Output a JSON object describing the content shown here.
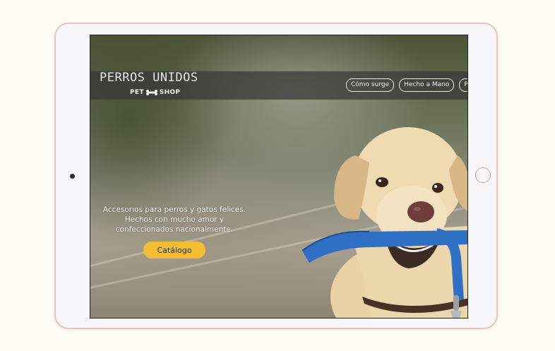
{
  "site": {
    "brand_name": "PERROS UNIDOS",
    "logo_left": "PET",
    "logo_right": "SHOP",
    "logo_icon": "bone-icon"
  },
  "nav": {
    "items": [
      {
        "label": "Cómo surge"
      },
      {
        "label": "Hecho a Mano"
      },
      {
        "label": "P"
      }
    ]
  },
  "hero": {
    "tagline_line1": "Accesorios  para perros y gatos felices.",
    "tagline_line2": "Hechos con mucho amor y",
    "tagline_line3": "confeccionados nacionalmente.",
    "cta_label": "Catálogo",
    "cta_color": "#f3bd35",
    "image": "labrador-with-blue-leash"
  },
  "device": {
    "frame_color": "#f7f7f9",
    "accent_color": "#eac2c0"
  }
}
